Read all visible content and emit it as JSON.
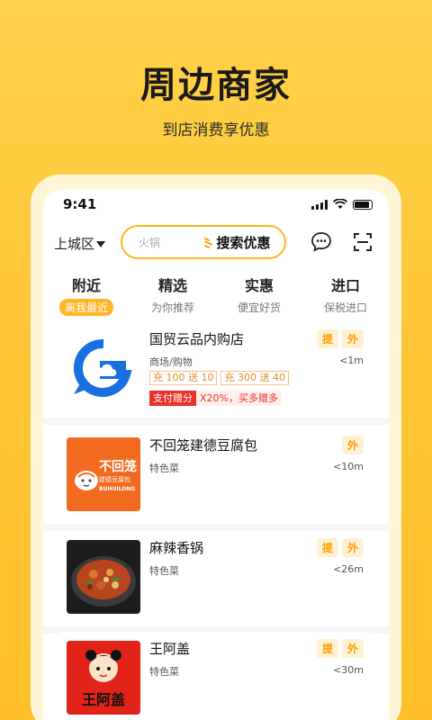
{
  "hero": {
    "title": "周边商家",
    "subtitle": "到店消费享优惠"
  },
  "status": {
    "time": "9:41"
  },
  "topbar": {
    "district": "上城区",
    "search_placeholder": "火锅",
    "search_button": "搜索优惠",
    "chat_icon": "chat-bubble-icon",
    "scan_icon": "scan-icon"
  },
  "tabs": [
    {
      "label": "附近",
      "sub": "离我最近",
      "active": true
    },
    {
      "label": "精选",
      "sub": "为你推荐"
    },
    {
      "label": "实惠",
      "sub": "便宜好货"
    },
    {
      "label": "进口",
      "sub": "保税进口"
    }
  ],
  "shops": [
    {
      "name": "国贸云品内购店",
      "category": "商场/购物",
      "tags": [
        "提",
        "外"
      ],
      "distance": "<1m",
      "coupons": [
        "充 100 送 10",
        "充 300 送 40"
      ],
      "promo_badge": "支付赠分",
      "promo_text": "X20%，买多赠多",
      "logo": "g-cloud-logo"
    },
    {
      "name": "不回笼建德豆腐包",
      "category": "特色菜",
      "tags": [
        "外"
      ],
      "distance": "<10m",
      "logo_text_1": "不回笼",
      "logo_text_2": "建德豆腐包",
      "logo_text_3": "BUHUILONG"
    },
    {
      "name": "麻辣香锅",
      "category": "特色菜",
      "tags": [
        "提",
        "外"
      ],
      "distance": "<26m",
      "logo": "spicy-pot-photo"
    },
    {
      "name": "王阿盖",
      "category": "特色菜",
      "tags": [
        "提",
        "外"
      ],
      "distance": "<30m",
      "logo_text_1": "王阿盖"
    }
  ],
  "colors": {
    "accent": "#ffb524",
    "background": "#ffc93a",
    "promo_red": "#e8332a"
  }
}
